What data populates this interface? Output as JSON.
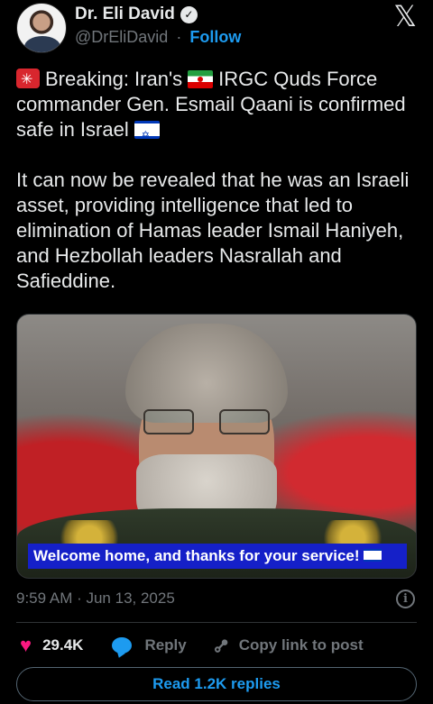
{
  "author": {
    "name": "Dr. Eli David",
    "handle": "@DrEliDavid",
    "separator": "·",
    "follow_label": "Follow"
  },
  "tweet": {
    "paragraph1": {
      "part_a": "Breaking: Iran's",
      "part_b": "IRGC Quds Force commander Gen. Esmail Qaani is confirmed safe in Israel"
    },
    "paragraph2": "It can now be revealed that he was an Israeli asset, providing intelligence that led to elimination of Hamas leader Ismail Haniyeh, and Hezbollah leaders Nasrallah and Safieddine."
  },
  "media": {
    "caption": "Welcome home, and thanks for your service!"
  },
  "meta": {
    "timestamp": "9:59 AM · Jun 13, 2025"
  },
  "actions": {
    "likes": "29.4K",
    "reply_label": "Reply",
    "copy_link_label": "Copy link to post"
  },
  "replies_button_label": "Read 1.2K replies",
  "icons": {
    "verified": "verified-badge-icon",
    "x_logo": "x-logo-icon",
    "siren": "siren-emoji-icon",
    "iran_flag": "iran-flag-emoji-icon",
    "israel_flag": "israel-flag-emoji-icon",
    "info": "info-icon",
    "heart": "heart-icon",
    "reply": "reply-bubble-icon",
    "link": "link-icon"
  },
  "colors": {
    "background": "#000000",
    "text": "#e7e9ea",
    "muted": "#71767b",
    "accent": "#1d9bf0",
    "like": "#f91880",
    "caption_bg": "#1520c8"
  }
}
